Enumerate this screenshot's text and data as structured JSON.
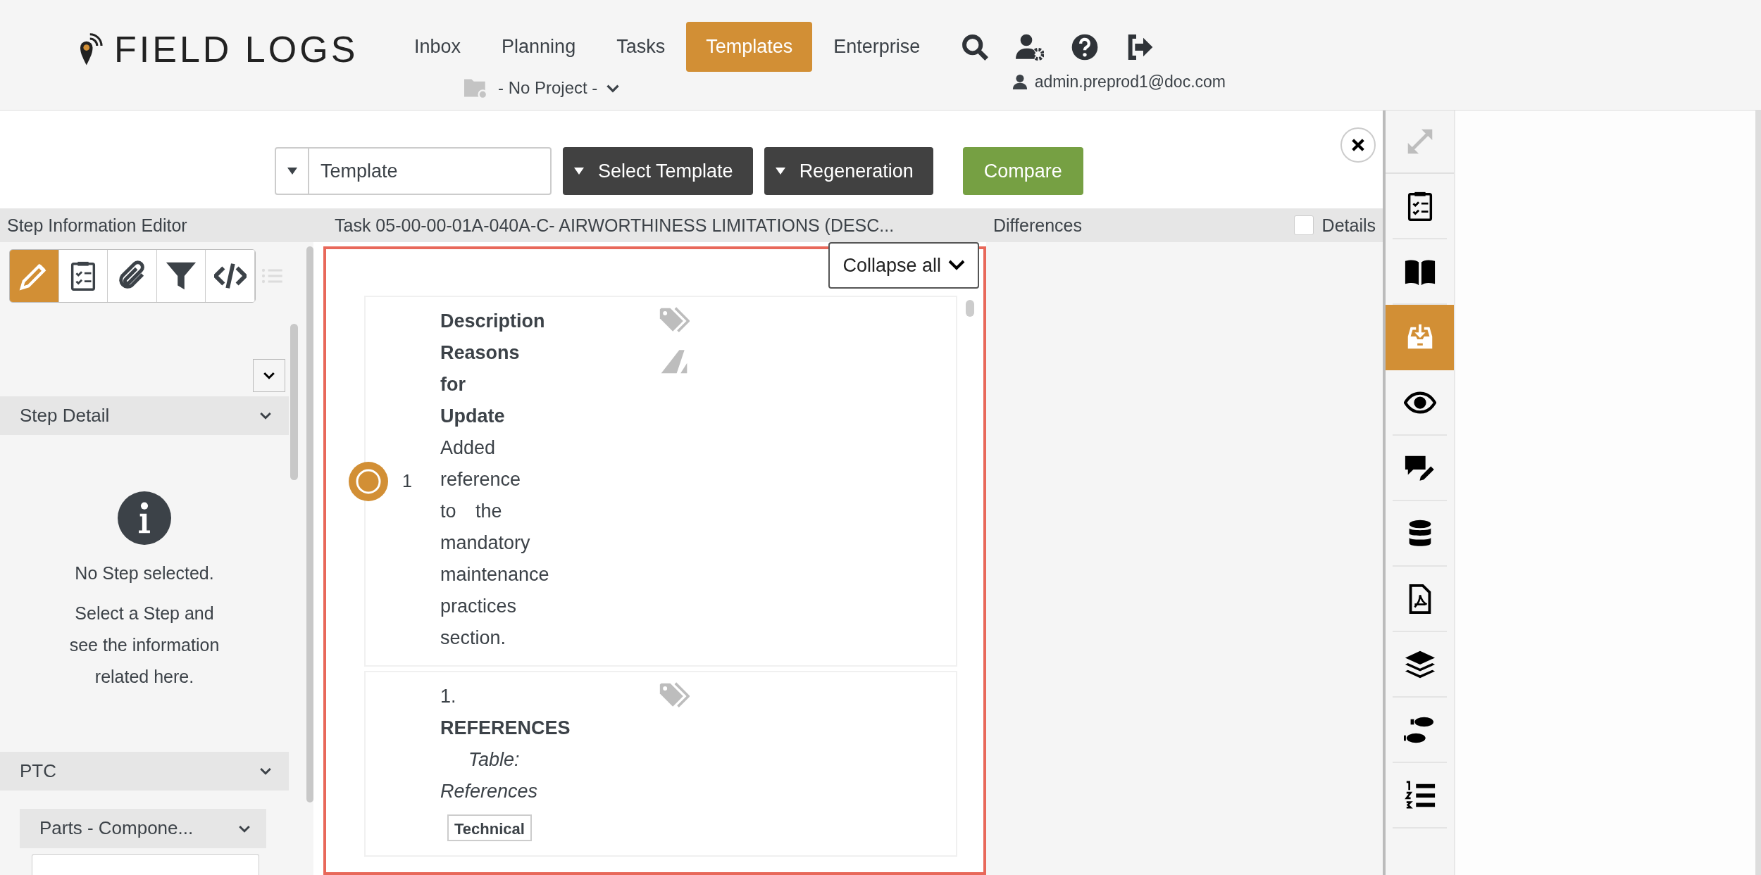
{
  "header": {
    "logo": "FIELD LOGS",
    "nav": [
      {
        "label": "Inbox",
        "selected": false
      },
      {
        "label": "Planning",
        "selected": false
      },
      {
        "label": "Tasks",
        "selected": false
      },
      {
        "label": "Templates",
        "selected": true
      },
      {
        "label": "Enterprise",
        "selected": false
      }
    ],
    "actions": [
      {
        "kind": "search"
      },
      {
        "kind": "user-settings"
      },
      {
        "kind": "help"
      },
      {
        "kind": "logout"
      }
    ],
    "project": "- No Project -",
    "user": "admin.preprod1@doc.com"
  },
  "toolbar": {
    "template_field": {
      "value": "Template"
    },
    "buttons": [
      {
        "label": "Select Template",
        "kind": "dropdown"
      },
      {
        "label": "Regeneration",
        "kind": "dropdown"
      },
      {
        "label": "Compare",
        "kind": "primary"
      }
    ]
  },
  "panels": {
    "left_title": "Step Information Editor",
    "center_title": "Task 05-00-00-01A-040A-C- AIRWORTHINESS LIMITATIONS (DESC...",
    "right_title": "Differences",
    "details": {
      "label": "Details",
      "checked": false
    }
  },
  "editor_tools": [
    {
      "kind": "edit",
      "selected": true,
      "disabled": false
    },
    {
      "kind": "checklist",
      "selected": false,
      "disabled": false
    },
    {
      "kind": "attachment",
      "selected": false,
      "disabled": false
    },
    {
      "kind": "filter",
      "selected": false,
      "disabled": false
    },
    {
      "kind": "code",
      "selected": false,
      "disabled": false
    },
    {
      "kind": "list",
      "selected": false,
      "disabled": true
    }
  ],
  "sections": [
    {
      "title": "Step Detail",
      "expanded": true,
      "empty_title": "No Step selected.",
      "empty_text": "Select a Step and see the information related here."
    },
    {
      "title": "PTC",
      "expanded": true,
      "dropdown": "Parts - Compone..."
    }
  ],
  "collapse_button": "Collapse all",
  "steps": [
    {
      "number": "1",
      "heading": "Description Reasons for Update",
      "body": "Added reference to the mandatory maintenance practices section.",
      "markers": [
        {
          "kind": "tag"
        },
        {
          "kind": "slant"
        }
      ]
    },
    {
      "title": "1.",
      "heading": "REFERENCES",
      "caption": "Table: References",
      "table_header": "Technical",
      "markers": [
        {
          "kind": "tag"
        }
      ]
    }
  ],
  "side_tools": [
    {
      "kind": "expand",
      "selected": false,
      "disabled": true
    },
    {
      "kind": "checklist",
      "selected": false,
      "disabled": false
    },
    {
      "kind": "book",
      "selected": false,
      "disabled": false
    },
    {
      "kind": "inbox",
      "selected": true,
      "disabled": false
    },
    {
      "kind": "eye",
      "selected": false,
      "disabled": false
    },
    {
      "kind": "comment-edit",
      "selected": false,
      "disabled": false
    },
    {
      "kind": "database",
      "selected": false,
      "disabled": false
    },
    {
      "kind": "pdf",
      "selected": false,
      "disabled": false
    },
    {
      "kind": "layers",
      "selected": false,
      "disabled": false
    },
    {
      "kind": "footsteps",
      "selected": false,
      "disabled": false
    },
    {
      "kind": "ordered-list",
      "selected": false,
      "disabled": false
    }
  ]
}
